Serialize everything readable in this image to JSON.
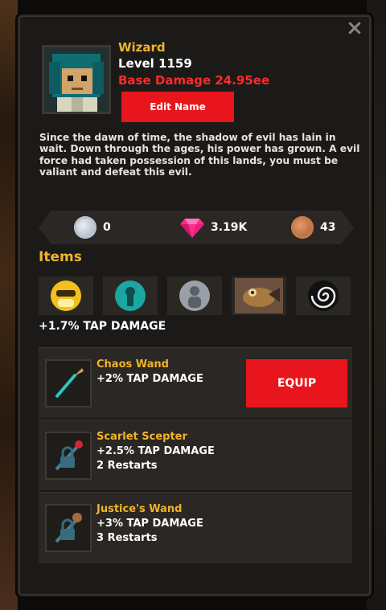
{
  "hero": {
    "name": "Wizard",
    "level": "Level 1159",
    "base_damage": "Base Damage 24.95ee",
    "edit_name_label": "Edit Name",
    "lore": "Since the dawn of time, the shadow of evil has lain in wait. Down through the ages, his power has grown. A evil force had taken possession of this lands, you must be valiant and defeat this evil."
  },
  "currencies": [
    {
      "icon": "silver-coin-icon",
      "value": "0"
    },
    {
      "icon": "pink-gem-icon",
      "value": "3.19K"
    },
    {
      "icon": "bronze-coin-icon",
      "value": "43"
    }
  ],
  "items": {
    "title": "Items",
    "slots": [
      {
        "icon": "golden-mask-icon"
      },
      {
        "icon": "teal-keyhole-icon"
      },
      {
        "icon": "grey-figure-icon"
      },
      {
        "icon": "brown-creature-icon"
      },
      {
        "icon": "spiral-vortex-icon"
      }
    ],
    "bonus": "+1.7% TAP DAMAGE"
  },
  "weapons": [
    {
      "name": "Chaos Wand",
      "bonus": "+2% TAP DAMAGE",
      "requirement": "",
      "locked": false,
      "action_label": "EQUIP"
    },
    {
      "name": "Scarlet Scepter",
      "bonus": "+2.5% TAP DAMAGE",
      "requirement": "2 Restarts",
      "locked": true
    },
    {
      "name": "Justice's Wand",
      "bonus": "+3% TAP DAMAGE",
      "requirement": "3 Restarts",
      "locked": true
    }
  ],
  "close_label": "×",
  "colors": {
    "gold": "#f0b429",
    "red": "#e8161c",
    "damage_red": "#ff2a2a",
    "panel": "#1b1a18",
    "row": "#2a2724"
  }
}
